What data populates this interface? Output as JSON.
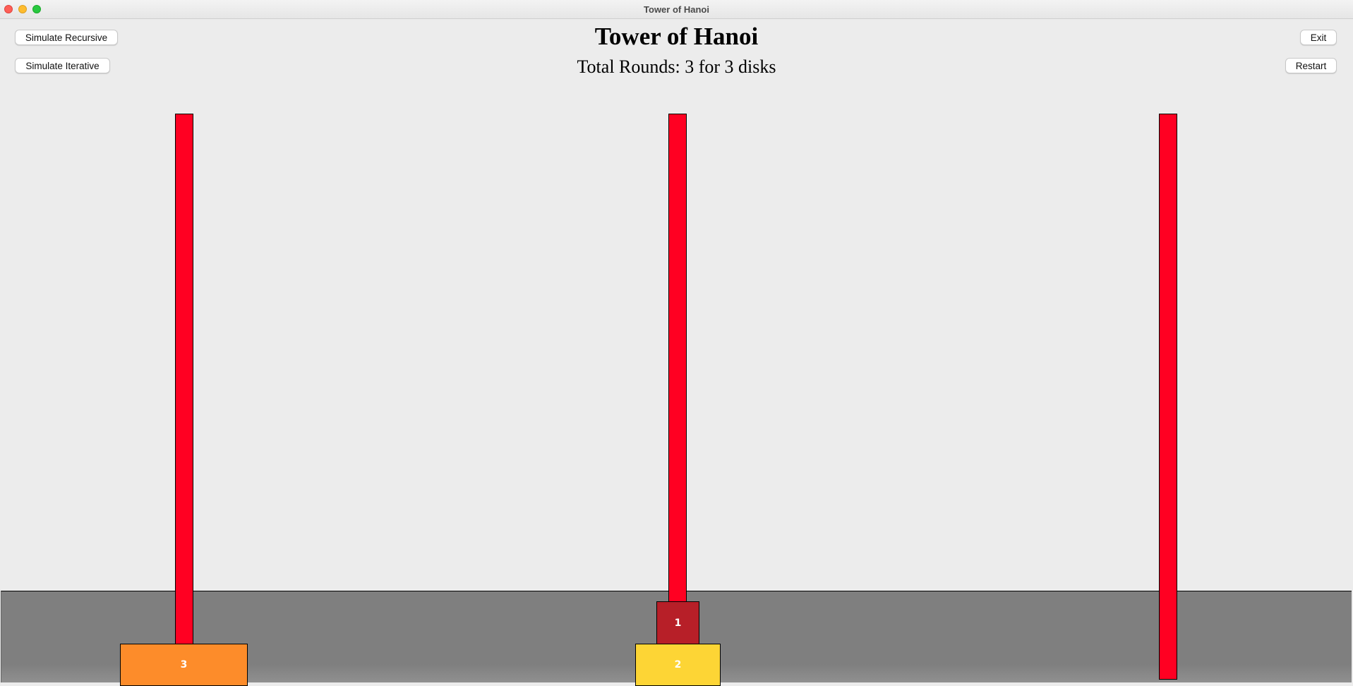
{
  "window": {
    "title": "Tower of Hanoi"
  },
  "buttons": {
    "simulate_recursive": "Simulate Recursive",
    "simulate_iterative": "Simulate Iterative",
    "exit": "Exit",
    "restart": "Restart"
  },
  "game": {
    "title": "Tower of Hanoi",
    "rounds_text": "Total Rounds: 3 for 3 disks"
  },
  "disks": [
    {
      "label": "1",
      "peg": 2,
      "color": "#b71f28"
    },
    {
      "label": "2",
      "peg": 2,
      "color": "#fdd535"
    },
    {
      "label": "3",
      "peg": 1,
      "color": "#fd8c2a"
    }
  ],
  "colors": {
    "peg": "#ff0022",
    "floor": "#808080",
    "background": "#ececec"
  }
}
